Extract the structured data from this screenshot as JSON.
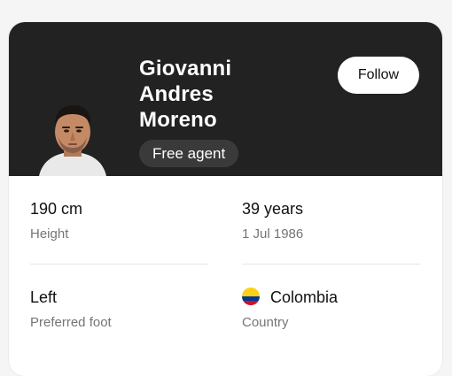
{
  "player": {
    "name_lines": [
      "Giovanni",
      "Andres",
      "Moreno"
    ],
    "status": "Free agent"
  },
  "actions": {
    "follow_label": "Follow"
  },
  "stats": {
    "height": {
      "value": "190 cm",
      "label": "Height"
    },
    "age": {
      "value": "39 years",
      "label": "1 Jul 1986"
    },
    "foot": {
      "value": "Left",
      "label": "Preferred foot"
    },
    "country": {
      "value": "Colombia",
      "label": "Country",
      "flag_icon": "colombia-flag-icon"
    }
  },
  "colors": {
    "header_bg": "#222222",
    "badge_bg": "#3a3a3a",
    "label_text": "#757575",
    "flag_yellow": "#fcd116",
    "flag_blue": "#003893",
    "flag_red": "#ce1126"
  }
}
